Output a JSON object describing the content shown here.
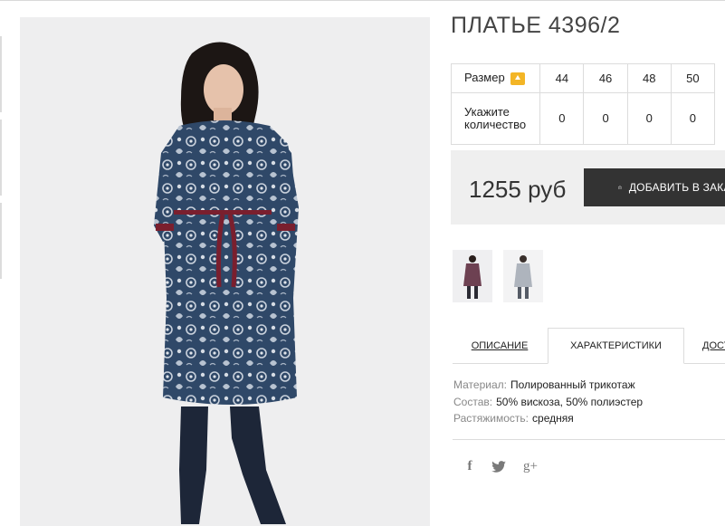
{
  "product": {
    "title": "ПЛАТЬЕ 4396/2",
    "price": "1255 руб",
    "add_to_cart_label": "ДОБАВИТЬ В ЗАКАЗ"
  },
  "size_table": {
    "size_label": "Размер",
    "size_icon": "size-chart-icon",
    "qty_label_line1": "Укажите",
    "qty_label_line2": "количество",
    "sizes": [
      "44",
      "46",
      "48",
      "50"
    ],
    "quantities": [
      "0",
      "0",
      "0",
      "0"
    ]
  },
  "tabs": {
    "description": "ОПИСАНИЕ",
    "characteristics": "ХАРАКТЕРИСТИКИ",
    "delivery": "ДОСТАВКА",
    "active": "characteristics"
  },
  "characteristics": [
    {
      "key": "Материал:",
      "value": "Полированный трикотаж"
    },
    {
      "key": "Состав:",
      "value": "50% вискоза, 50% полиэстер"
    },
    {
      "key": "Растяжимость:",
      "value": "средняя"
    }
  ],
  "social": {
    "facebook": "f",
    "twitter": "twitter-icon",
    "googleplus": "g+"
  },
  "colors": {
    "button_bg": "#333333",
    "price_box_bg": "#efefef",
    "size_icon": "#f3b526",
    "dress_navy": "#2e4566",
    "belt_burgundy": "#7a1f2e"
  }
}
